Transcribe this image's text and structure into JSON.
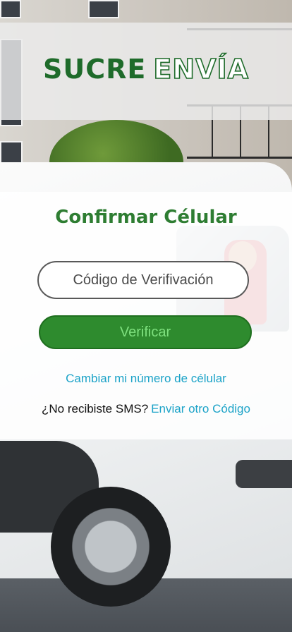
{
  "header": {
    "logo_part1": "SUCRE",
    "logo_part2": "ENVÍA",
    "brand_color": "#1e6b2a"
  },
  "form": {
    "title": "Confirmar Célular",
    "code_placeholder": "Código de Verifivación",
    "verify_label": "Verificar",
    "change_number_link": "Cambiar mi número de célular",
    "sms_prompt": "¿No recibiste SMS?",
    "resend_link": "Enviar otro Código"
  },
  "colors": {
    "title_green": "#2e7d32",
    "button_green": "#2e8b2e",
    "link_blue": "#1ca3c8"
  }
}
